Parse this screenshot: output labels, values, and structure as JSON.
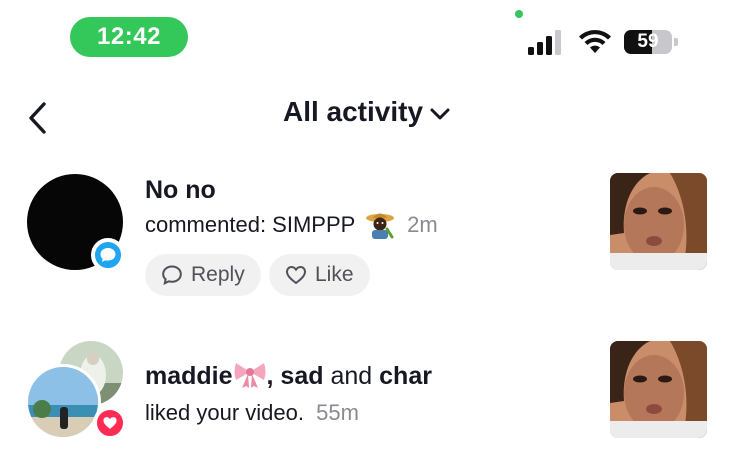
{
  "status_bar": {
    "time": "12:42",
    "battery": "59",
    "battery_level": 0.59,
    "accent": "#34c759"
  },
  "header": {
    "back_icon": "chevron-left-icon",
    "title": "All activity",
    "dropdown_icon": "chevron-down-icon"
  },
  "activities": [
    {
      "name": "No no",
      "action": "commented: SIMPPP",
      "emoji_icon": "farmer-emoji-icon",
      "time": "2m",
      "badge_icon": "comment-bubble-icon",
      "badge_color": "#20a5f0",
      "buttons": {
        "reply_label": "Reply",
        "like_label": "Like"
      }
    },
    {
      "name_part1": "maddie",
      "ribbon_icon": "ribbon-emoji-icon",
      "name_part2": ", sad",
      "name_conjunction": "and",
      "name_part3": "char",
      "action": "liked your video.",
      "time": "55m",
      "badge_icon": "heart-icon",
      "badge_color": "#fe2c55"
    }
  ]
}
